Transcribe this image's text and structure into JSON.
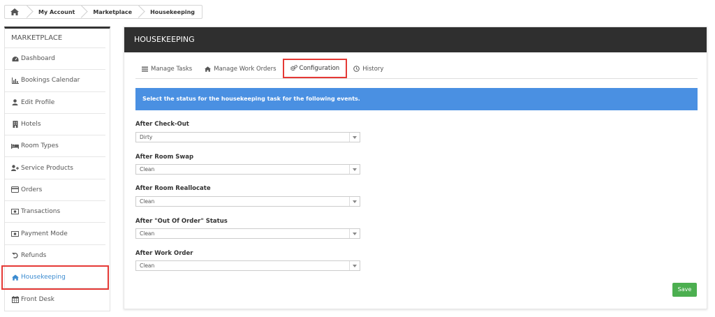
{
  "breadcrumb": {
    "home_icon": "home-icon",
    "items": [
      "My Account",
      "Marketplace",
      "Housekeeping"
    ]
  },
  "sidebar": {
    "title": "MARKETPLACE",
    "items": [
      {
        "label": "Dashboard",
        "icon": "tachometer-icon"
      },
      {
        "label": "Bookings Calendar",
        "icon": "bar-chart-icon"
      },
      {
        "label": "Edit Profile",
        "icon": "user-icon"
      },
      {
        "label": "Hotels",
        "icon": "building-icon"
      },
      {
        "label": "Room Types",
        "icon": "bed-icon"
      },
      {
        "label": "Service Products",
        "icon": "user-plus-icon"
      },
      {
        "label": "Orders",
        "icon": "credit-card-icon"
      },
      {
        "label": "Transactions",
        "icon": "money-icon"
      },
      {
        "label": "Payment Mode",
        "icon": "money-icon"
      },
      {
        "label": "Refunds",
        "icon": "undo-icon"
      },
      {
        "label": "Housekeeping",
        "icon": "home-icon",
        "active": true
      },
      {
        "label": "Front Desk",
        "icon": "calendar-icon"
      }
    ]
  },
  "panel": {
    "title": "HOUSEKEEPING",
    "tabs": [
      {
        "label": "Manage Tasks",
        "icon": "list-icon"
      },
      {
        "label": "Manage Work Orders",
        "icon": "home-icon"
      },
      {
        "label": "Configuration",
        "icon": "cogs-icon",
        "active": true
      },
      {
        "label": "History",
        "icon": "clock-icon"
      }
    ],
    "info": "Select the status for the housekeeping task for the following events.",
    "fields": [
      {
        "label": "After Check-Out",
        "value": "Dirty"
      },
      {
        "label": "After Room Swap",
        "value": "Clean"
      },
      {
        "label": "After Room Reallocate",
        "value": "Clean"
      },
      {
        "label": "After \"Out Of Order\" Status",
        "value": "Clean"
      },
      {
        "label": "After Work Order",
        "value": "Clean"
      }
    ],
    "save_label": "Save"
  },
  "colors": {
    "accent": "#3b8bd0",
    "info_bar": "#4a90e2",
    "save": "#4caf50",
    "highlight": "#e53935",
    "header": "#2f2f2f"
  }
}
